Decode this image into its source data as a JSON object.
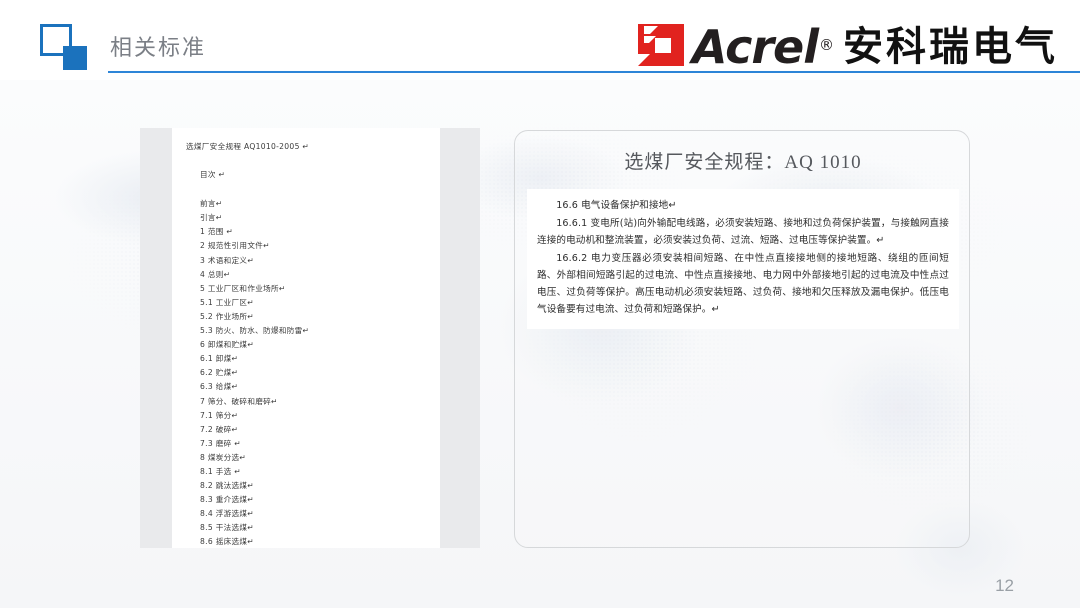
{
  "slide": {
    "page_number": "12",
    "accent_color": "#2e86d8",
    "brand_red": "#e1231f",
    "title_color": "#7b7f86"
  },
  "header": {
    "title": "相关标准",
    "logo_icon": "square-overlap-icon"
  },
  "brand": {
    "mark_icon": "acrel-red-square-icon",
    "word": "Acrel",
    "registered": "®",
    "chinese": "安科瑞电气"
  },
  "document_panel": {
    "name": "xuanmeichang-toc-document",
    "heading": "选煤厂安全规程 AQ1010-2005 ↵",
    "toc_label": "目次 ↵",
    "toc_items": [
      "前言↵",
      "引言↵",
      "1 范围 ↵",
      "2 规范性引用文件↵",
      "3 术语和定义↵",
      "4 总则↵",
      "5 工业厂区和作业场所↵",
      "5.1 工业厂区↵",
      "5.2 作业场所↵",
      "5.3 防火、防水、防爆和防雷↵",
      "6 卸煤和贮煤↵",
      "6.1 卸煤↵",
      "6.2 贮煤↵",
      "6.3 给煤↵",
      "7 筛分、破碎和磨碎↵",
      "7.1 筛分↵",
      "7.2 破碎↵",
      "7.3 磨碎 ↵",
      "8 煤炭分选↵",
      "8.1 手选 ↵",
      "8.2 跳汰选煤↵",
      "8.3 重介选煤↵",
      "8.4 浮游选煤↵",
      "8.5 干法选煤↵",
      "8.6 摇床选煤↵"
    ]
  },
  "standard_panel": {
    "title": "选煤厂安全规程：AQ 1010",
    "paragraphs": [
      "16.6 电气设备保护和接地↵",
      "16.6.1 变电所(站)向外输配电线路，必须安装短路、接地和过负荷保护装置，与接触网直接连接的电动机和整流装置，必须安装过负荷、过流、短路、过电压等保护装置。↵",
      "16.6.2 电力变压器必须安装相间短路、在中性点直接接地侧的接地短路、绕组的匝间短路、外部相间短路引起的过电流、中性点直接接地、电力网中外部接地引起的过电流及中性点过电压、过负荷等保护。高压电动机必须安装短路、过负荷、接地和欠压释放及漏电保护。低压电气设备要有过电流、过负荷和短路保护。↵"
    ]
  }
}
